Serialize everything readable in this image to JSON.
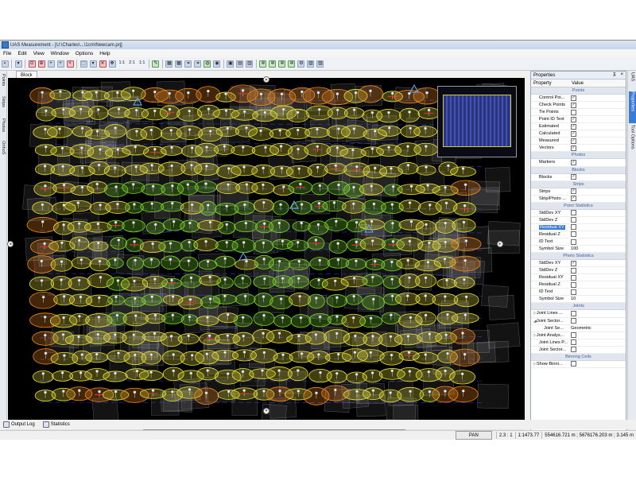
{
  "window": {
    "title": "UAS Measurement - [U:\\Charles\\...\\1cm\\Newcam.prj]"
  },
  "menu": [
    "File",
    "Edit",
    "View",
    "Window",
    "Options",
    "Help"
  ],
  "toolbar": {
    "zoom_labels": [
      "1:1",
      "2:1",
      "1:1"
    ]
  },
  "left_tabs": [
    "Points",
    "Strips",
    "Photos",
    "OrthoS"
  ],
  "doc_tab": "Block",
  "properties": {
    "title": "Properties",
    "col_property": "Property",
    "col_value": "Value",
    "rows": [
      {
        "kind": "section",
        "label": "Points"
      },
      {
        "kind": "check",
        "label": "Control Poi...",
        "checked": true
      },
      {
        "kind": "check",
        "label": "Check Points",
        "checked": true
      },
      {
        "kind": "check",
        "label": "Tie Points",
        "checked": false
      },
      {
        "kind": "check",
        "label": "Point ID Text",
        "checked": true
      },
      {
        "kind": "check",
        "label": "Estimated",
        "checked": true
      },
      {
        "kind": "check",
        "label": "Calculated",
        "checked": true
      },
      {
        "kind": "check",
        "label": "Measured",
        "checked": true
      },
      {
        "kind": "check",
        "label": "Vectors",
        "checked": true
      },
      {
        "kind": "section",
        "label": "Photos"
      },
      {
        "kind": "check",
        "label": "Markers",
        "checked": true
      },
      {
        "kind": "section",
        "label": "Blocks"
      },
      {
        "kind": "check",
        "label": "Blocks",
        "checked": true
      },
      {
        "kind": "section",
        "label": "Strips"
      },
      {
        "kind": "check",
        "label": "Strips",
        "checked": true
      },
      {
        "kind": "check",
        "label": "Strip/Photo ...",
        "checked": true
      },
      {
        "kind": "section",
        "label": "Point Statistics"
      },
      {
        "kind": "check",
        "label": "StdDev XY",
        "checked": false
      },
      {
        "kind": "check",
        "label": "StdDev Z",
        "checked": false
      },
      {
        "kind": "check",
        "label": "Residual XY",
        "checked": false,
        "selected": true
      },
      {
        "kind": "check",
        "label": "Residual Z",
        "checked": false
      },
      {
        "kind": "check",
        "label": "ID Text",
        "checked": false
      },
      {
        "kind": "text",
        "label": "Symbol Size",
        "value": "100"
      },
      {
        "kind": "section",
        "label": "Photo Statistics"
      },
      {
        "kind": "check",
        "label": "StdDev XY",
        "checked": true
      },
      {
        "kind": "check",
        "label": "StdDev Z",
        "checked": false
      },
      {
        "kind": "check",
        "label": "Residual XY",
        "checked": false
      },
      {
        "kind": "check",
        "label": "Residual Z",
        "checked": false
      },
      {
        "kind": "check",
        "label": "ID Text",
        "checked": false
      },
      {
        "kind": "text",
        "label": "Symbol Size",
        "value": "10"
      },
      {
        "kind": "section",
        "label": "Joints"
      },
      {
        "kind": "check",
        "label": "Joint Lines ...",
        "checked": false,
        "expander": "▷"
      },
      {
        "kind": "check",
        "label": "Joint Sector...",
        "checked": false,
        "expander": "◢"
      },
      {
        "kind": "text",
        "label": "Joint Se...",
        "value": "Geometric",
        "indent": true
      },
      {
        "kind": "check",
        "label": "Joint Analys...",
        "checked": false,
        "expander": "▷"
      },
      {
        "kind": "check",
        "label": "Joint Lines P...",
        "checked": false
      },
      {
        "kind": "check",
        "label": "Joint Sector...",
        "checked": false
      },
      {
        "kind": "section",
        "label": "Binning Cells"
      },
      {
        "kind": "check",
        "label": "Show Binni...",
        "checked": false,
        "expander": "▷"
      }
    ]
  },
  "right_tabs": [
    "UAS",
    "Properties",
    "Tool Options"
  ],
  "bottom_tabs": [
    "Output Log",
    "Statistics"
  ],
  "status": {
    "mode": "PAN",
    "zoom": "2.3 : 1",
    "scale": "1:1473.77",
    "coords": "554616.721 m ; 5676176.203 m ; 3.145 m"
  },
  "colors": {
    "ellipse_yellow": "#e8e23a",
    "ellipse_orange": "#f08a1c",
    "ellipse_green": "#7ed62a",
    "vector_blue": "#2f3fd8",
    "selection": "#3a7bd5"
  }
}
